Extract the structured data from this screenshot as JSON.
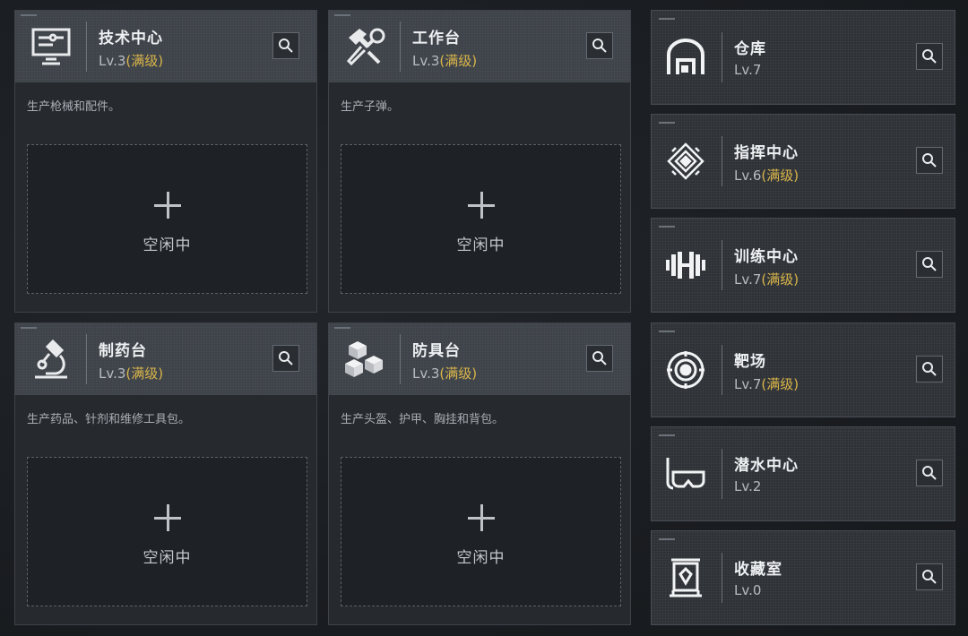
{
  "workbenches": [
    {
      "id": "tech",
      "title": "技术中心",
      "level": "Lv.3",
      "max_tag": "(满级)",
      "icon": "computer-circuit-icon",
      "description": "生产枪械和配件。",
      "slot_label": "空闲中"
    },
    {
      "id": "workbench",
      "title": "工作台",
      "level": "Lv.3",
      "max_tag": "(满级)",
      "icon": "hammer-wrench-icon",
      "description": "生产子弹。",
      "slot_label": "空闲中"
    },
    {
      "id": "pharmacy",
      "title": "制药台",
      "level": "Lv.3",
      "max_tag": "(满级)",
      "icon": "microscope-icon",
      "description": "生产药品、针剂和维修工具包。",
      "slot_label": "空闲中"
    },
    {
      "id": "armor",
      "title": "防具台",
      "level": "Lv.3",
      "max_tag": "(满级)",
      "icon": "stacked-boxes-icon",
      "description": "生产头盔、护甲、胸挂和背包。",
      "slot_label": "空闲中"
    }
  ],
  "facilities": [
    {
      "id": "warehouse",
      "title": "仓库",
      "level": "Lv.7",
      "max_tag": "",
      "icon": "warehouse-icon"
    },
    {
      "id": "command",
      "title": "指挥中心",
      "level": "Lv.6",
      "max_tag": "(满级)",
      "icon": "command-emblem-icon"
    },
    {
      "id": "training",
      "title": "训练中心",
      "level": "Lv.7",
      "max_tag": "(满级)",
      "icon": "dumbbell-icon"
    },
    {
      "id": "range",
      "title": "靶场",
      "level": "Lv.7",
      "max_tag": "(满级)",
      "icon": "target-icon"
    },
    {
      "id": "diving",
      "title": "潜水中心",
      "level": "Lv.2",
      "max_tag": "",
      "icon": "diving-mask-icon"
    },
    {
      "id": "collection",
      "title": "收藏室",
      "level": "Lv.0",
      "max_tag": "",
      "icon": "display-case-icon"
    }
  ],
  "colors": {
    "max_level": "#d9b54a",
    "card_header": "#3e4349",
    "card_body": "#262a2f"
  }
}
